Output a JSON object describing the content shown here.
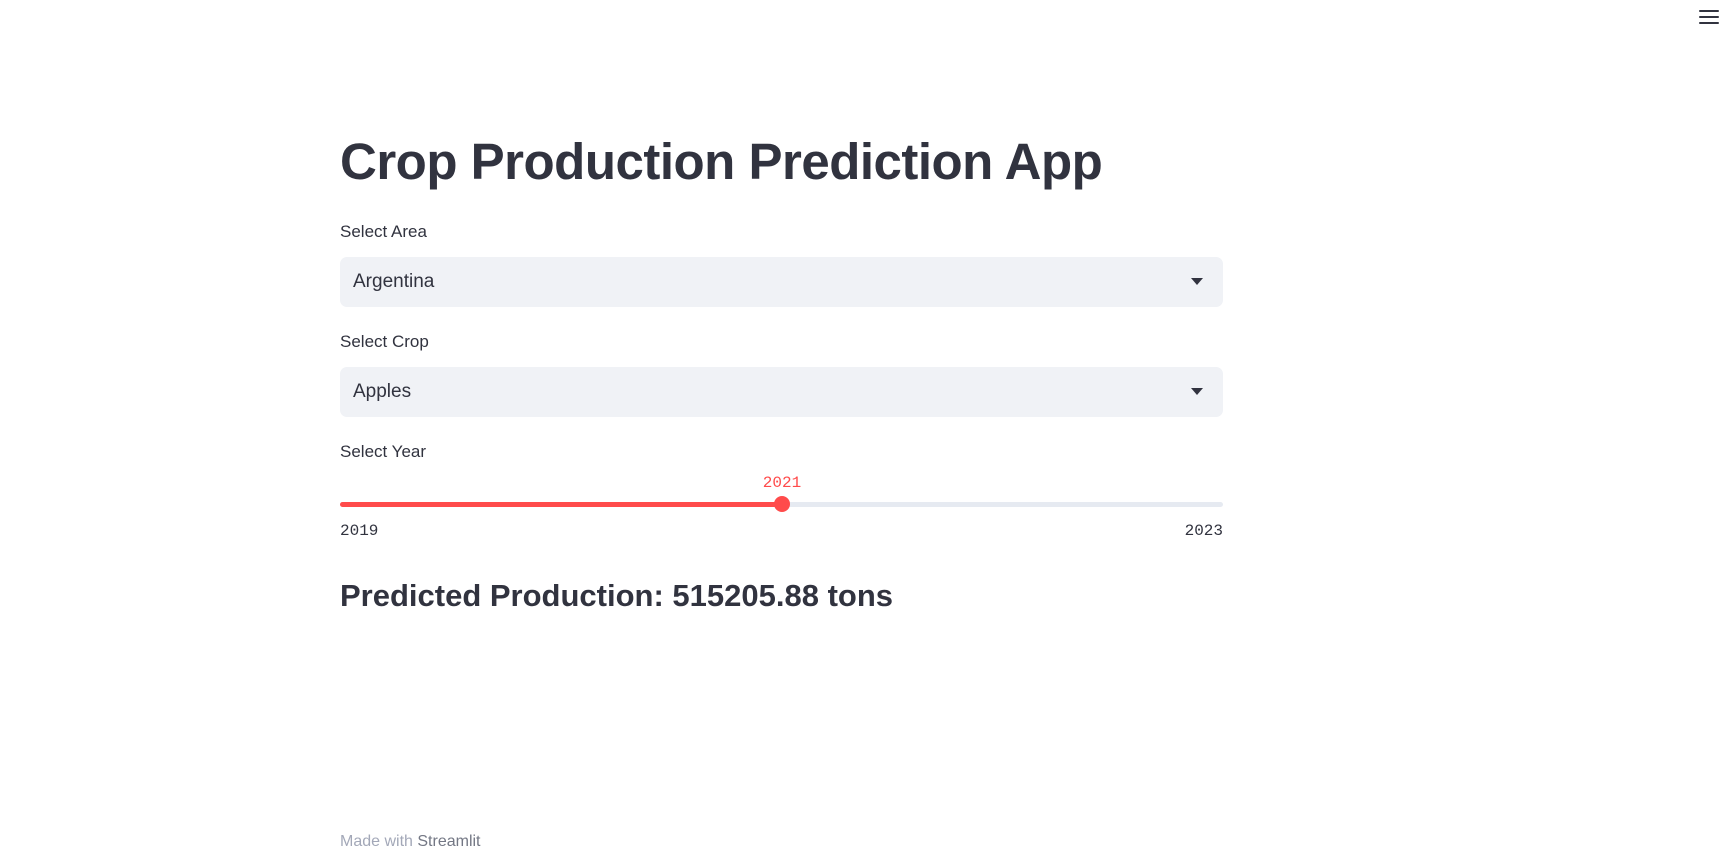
{
  "app": {
    "title": "Crop Production Prediction App"
  },
  "header": {
    "menu_icon": "hamburger-menu-icon"
  },
  "area": {
    "label": "Select Area",
    "value": "Argentina"
  },
  "crop": {
    "label": "Select Crop",
    "value": "Apples"
  },
  "year": {
    "label": "Select Year",
    "value": "2021",
    "min": "2019",
    "max": "2023",
    "fraction": 0.5
  },
  "result": {
    "text": "Predicted Production: 515205.88 tons"
  },
  "footer": {
    "prefix": "Made with",
    "brand": "Streamlit"
  },
  "colors": {
    "accent": "#ff4b4b",
    "text": "#31333f",
    "select_bg": "#f0f2f6"
  }
}
